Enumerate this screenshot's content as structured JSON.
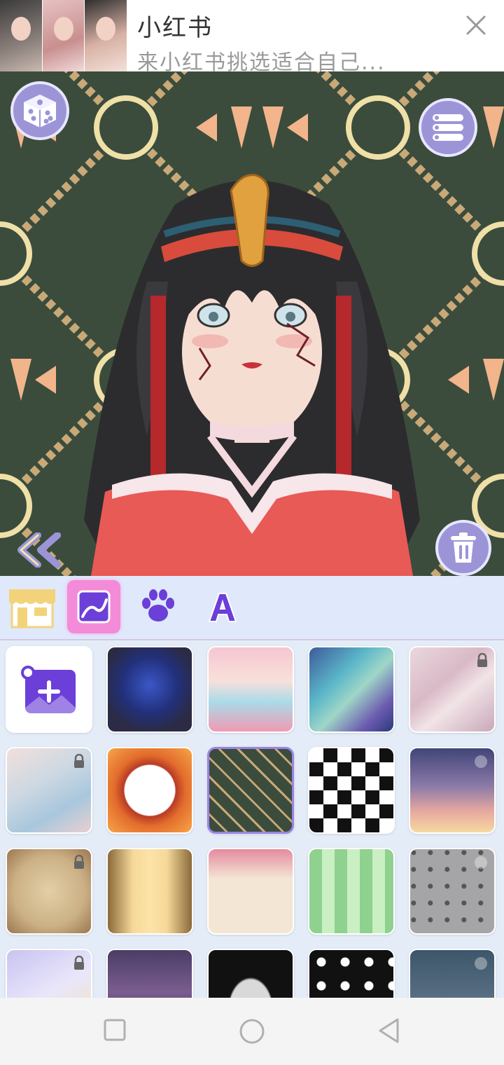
{
  "ad": {
    "title": "小红书",
    "subtitle": "来小红书挑选适合自己..."
  },
  "toolbar": {
    "tabs": [
      {
        "name": "shop",
        "icon": "shop-icon"
      },
      {
        "name": "background",
        "icon": "background-icon",
        "selected": true
      },
      {
        "name": "pet",
        "icon": "paw-icon"
      },
      {
        "name": "text",
        "icon": "text-a-icon",
        "label": "A"
      }
    ]
  },
  "backgrounds": [
    {
      "name": "add-photo",
      "locked": false
    },
    {
      "name": "galaxy-planet",
      "locked": false
    },
    {
      "name": "pastel-clouds",
      "locked": false
    },
    {
      "name": "blue-wave",
      "locked": false
    },
    {
      "name": "pink-marble",
      "locked": true
    },
    {
      "name": "watercolor-blue-pink",
      "locked": true
    },
    {
      "name": "orange-mandala",
      "locked": false
    },
    {
      "name": "green-geometric",
      "locked": false,
      "selected": true
    },
    {
      "name": "checkerboard",
      "locked": false
    },
    {
      "name": "sunset-sky",
      "locked": false,
      "video": true
    },
    {
      "name": "old-paper",
      "locked": true
    },
    {
      "name": "golden-wings",
      "locked": false
    },
    {
      "name": "floral-frame",
      "locked": false
    },
    {
      "name": "green-leaves",
      "locked": false
    },
    {
      "name": "skull-pattern",
      "locked": false,
      "video": true
    },
    {
      "name": "purple-splash",
      "locked": true
    },
    {
      "name": "night-mountains",
      "locked": false
    },
    {
      "name": "halloween-frame",
      "locked": false
    },
    {
      "name": "ghost-pattern",
      "locked": false
    },
    {
      "name": "moon-night",
      "locked": false,
      "video": true
    }
  ],
  "colors": {
    "accent": "#9b95d8",
    "selected_tab": "#f38bd8",
    "canvas_bg": "#3b4c3c"
  }
}
